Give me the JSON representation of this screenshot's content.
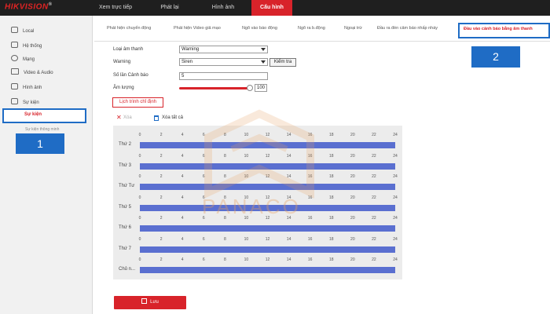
{
  "header": {
    "logo_red": "HIKVISION",
    "logo_mark": "®",
    "nav": [
      {
        "label": "Xem trực tiếp",
        "active": false
      },
      {
        "label": "Phát lại",
        "active": false
      },
      {
        "label": "Hình ảnh",
        "active": false
      },
      {
        "label": "Cấu hình",
        "active": true
      }
    ]
  },
  "sidebar": {
    "items": [
      {
        "label": "Local",
        "icon": "monitor-icon"
      },
      {
        "label": "Hệ thống",
        "icon": "system-icon"
      },
      {
        "label": "Mạng",
        "icon": "globe-icon"
      },
      {
        "label": "Video & Audio",
        "icon": "video-audio-icon"
      },
      {
        "label": "Hình ảnh",
        "icon": "image-icon"
      },
      {
        "label": "Sự kiện",
        "icon": "calendar-icon"
      }
    ],
    "active_sub": "Sự kiện",
    "next_sub": "Sự kiện thông minh"
  },
  "badges": {
    "one": "1",
    "two": "2"
  },
  "tabs": [
    {
      "label": "Phát hiện chuyển động"
    },
    {
      "label": "Phát hiện Video giả mạo"
    },
    {
      "label": "Ngõ vào báo động"
    },
    {
      "label": "Ngõ ra b.động"
    },
    {
      "label": "Ngoại trừ"
    },
    {
      "label": "Đầu ra đèn cảm báo nhấp nháy"
    }
  ],
  "active_tab": "Đầu vào cảnh báo bằng âm thanh",
  "form": {
    "sound_type_label": "Loại âm thanh",
    "sound_type_value": "Warning",
    "warning_label": "Warning",
    "warning_value": "Siren",
    "test_button": "Kiểm tra",
    "alarm_count_label": "Số lần Cảnh báo",
    "alarm_count_value": "5",
    "volume_label": "Âm lượng",
    "volume_value": "100"
  },
  "schedule": {
    "title_button": "Lịch trình chỉ định",
    "delete_label": "Xóa",
    "delete_all_label": "Xóa tất cả",
    "hours": [
      "0",
      "2",
      "4",
      "6",
      "8",
      "10",
      "12",
      "14",
      "16",
      "18",
      "20",
      "22",
      "24"
    ],
    "days": [
      "Thứ 2",
      "Thứ 3",
      "Thứ Tư",
      "Thứ 5",
      "Thứ 6",
      "Thứ 7",
      "Chủ n..."
    ]
  },
  "save_label": "Lưu",
  "watermark": "PANACO",
  "colors": {
    "accent": "#d8232a",
    "highlight": "#1f6cc5",
    "bar": "#5a6fd0"
  }
}
